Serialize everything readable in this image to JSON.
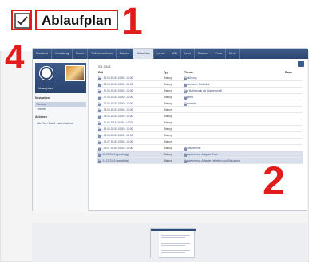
{
  "header": {
    "checkbox_checked": true,
    "title": "Ablaufplan",
    "annotation_colors": {
      "red": "#e21b1b"
    }
  },
  "annotations": {
    "n1": "1",
    "n2": "2",
    "n4": "4"
  },
  "nav": {
    "tabs": [
      {
        "label": "Übersicht",
        "active": false
      },
      {
        "label": "Verwaltung",
        "active": false
      },
      {
        "label": "Forum",
        "active": false
      },
      {
        "label": "Teilnehmer/innen",
        "active": false
      },
      {
        "label": "Dateien",
        "active": false
      },
      {
        "label": "Ablaufplan",
        "active": true
      },
      {
        "label": "Lernm",
        "active": false
      },
      {
        "label": "Wiki",
        "active": false
      },
      {
        "label": "Lexu",
        "active": false
      },
      {
        "label": "Studium",
        "active": false
      },
      {
        "label": "Portu",
        "active": false
      },
      {
        "label": "Mehr",
        "active": false
      }
    ]
  },
  "sidebar": {
    "title": "Ablaufplan",
    "navigation_label": "Navigation",
    "items": [
      "Termine",
      "Themen"
    ],
    "actions_label": "Aktionen",
    "action_item": "Alle Einz. Dateil. Laden/Sahnen"
  },
  "main": {
    "date": "SS 2015",
    "columns": [
      "Zeit",
      "Typ",
      "Thema",
      "Raum"
    ],
    "rows": [
      {
        "time": "Do., 16.04.2015, 10:00 - 12:00",
        "type": "Sitzung",
        "topic": "Einführung",
        "hl": false
      },
      {
        "time": "Do., 23.04.2015, 10:00 - 12:00",
        "type": "Sitzung",
        "topic": "Historischer Rückblick",
        "hl": false
      },
      {
        "time": "Do., 30.04.2015, 10:00 - 12:00",
        "type": "Sitzung",
        "topic": "Die Mathematik als Wissenschaft",
        "hl": false
      },
      {
        "time": "Do., 07.05.2015, 10:00 - 12:00",
        "type": "Sitzung",
        "topic": "Algebra",
        "hl": false
      },
      {
        "time": "Do., 21.05.2015, 10:00 - 12:00",
        "type": "Sitzung",
        "topic": "Geometrie",
        "hl": false
      },
      {
        "time": "Do., 28.05.2015, 10:00 - 12:00",
        "type": "Sitzung",
        "topic": "",
        "hl": false
      },
      {
        "time": "Do., 04.06.2015, 10:00 - 12:00",
        "type": "Sitzung",
        "topic": "",
        "hl": false
      },
      {
        "time": "Do., 11.06.2015, 10:00 - 12:00",
        "type": "Sitzung",
        "topic": "",
        "hl": false
      },
      {
        "time": "Do., 18.06.2015, 10:00 - 12:00",
        "type": "Sitzung",
        "topic": "",
        "hl": false
      },
      {
        "time": "Do., 25.06.2015, 10:00 - 12:00",
        "type": "Sitzung",
        "topic": "",
        "hl": false
      },
      {
        "time": "Do., 02.07.2015, 10:00 - 12:00",
        "type": "Sitzung",
        "topic": "",
        "hl": false
      },
      {
        "time": "Do., 09.07.2015, 10:00 - 12:00",
        "type": "Sitzung",
        "topic": "Wunschthema",
        "hl": false
      },
      {
        "time": "Fr., 10.07.2015 (ganztägig)",
        "type": "Sitzung",
        "topic": "Hauptseminar: Aufgabe Thea",
        "hl": true
      },
      {
        "time": "Fr., 24.07.2015 (ganztägig)",
        "type": "Sitzung",
        "topic": "Hauptseminar: Aufgabe Definition und Diskussion",
        "hl": true
      }
    ]
  }
}
